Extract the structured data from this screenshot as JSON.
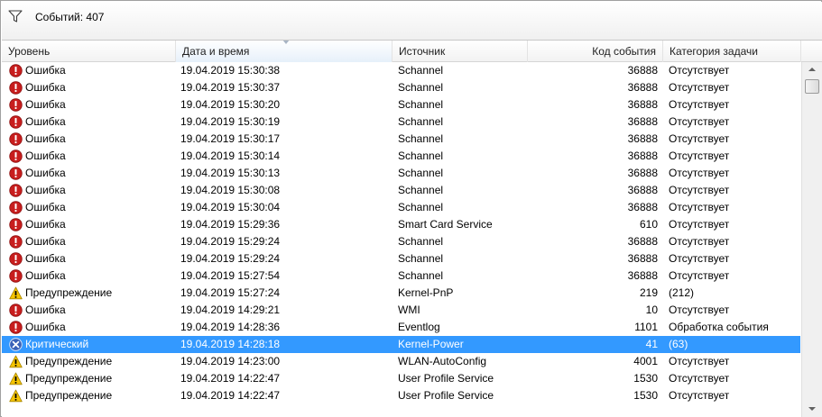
{
  "toolbar": {
    "filter_icon": "filter-icon",
    "events_count": "Событий: 407"
  },
  "columns": {
    "level": "Уровень",
    "datetime": "Дата и время",
    "source": "Источник",
    "event_code": "Код события",
    "task_category": "Категория задачи"
  },
  "icons": {
    "error": "error-icon",
    "warning": "warning-icon",
    "critical": "critical-icon"
  },
  "colors": {
    "selection": "#3399ff",
    "error_red": "#c81e1e",
    "warning_yellow": "#f5c400",
    "critical_blue": "#3a62b8"
  },
  "rows": [
    {
      "type": "error",
      "level": "Ошибка",
      "date": "19.04.2019 15:30:38",
      "source": "Schannel",
      "code": "36888",
      "category": "Отсутствует"
    },
    {
      "type": "error",
      "level": "Ошибка",
      "date": "19.04.2019 15:30:37",
      "source": "Schannel",
      "code": "36888",
      "category": "Отсутствует"
    },
    {
      "type": "error",
      "level": "Ошибка",
      "date": "19.04.2019 15:30:20",
      "source": "Schannel",
      "code": "36888",
      "category": "Отсутствует"
    },
    {
      "type": "error",
      "level": "Ошибка",
      "date": "19.04.2019 15:30:19",
      "source": "Schannel",
      "code": "36888",
      "category": "Отсутствует"
    },
    {
      "type": "error",
      "level": "Ошибка",
      "date": "19.04.2019 15:30:17",
      "source": "Schannel",
      "code": "36888",
      "category": "Отсутствует"
    },
    {
      "type": "error",
      "level": "Ошибка",
      "date": "19.04.2019 15:30:14",
      "source": "Schannel",
      "code": "36888",
      "category": "Отсутствует"
    },
    {
      "type": "error",
      "level": "Ошибка",
      "date": "19.04.2019 15:30:13",
      "source": "Schannel",
      "code": "36888",
      "category": "Отсутствует"
    },
    {
      "type": "error",
      "level": "Ошибка",
      "date": "19.04.2019 15:30:08",
      "source": "Schannel",
      "code": "36888",
      "category": "Отсутствует"
    },
    {
      "type": "error",
      "level": "Ошибка",
      "date": "19.04.2019 15:30:04",
      "source": "Schannel",
      "code": "36888",
      "category": "Отсутствует"
    },
    {
      "type": "error",
      "level": "Ошибка",
      "date": "19.04.2019 15:29:36",
      "source": "Smart Card Service",
      "code": "610",
      "category": "Отсутствует"
    },
    {
      "type": "error",
      "level": "Ошибка",
      "date": "19.04.2019 15:29:24",
      "source": "Schannel",
      "code": "36888",
      "category": "Отсутствует"
    },
    {
      "type": "error",
      "level": "Ошибка",
      "date": "19.04.2019 15:29:24",
      "source": "Schannel",
      "code": "36888",
      "category": "Отсутствует"
    },
    {
      "type": "error",
      "level": "Ошибка",
      "date": "19.04.2019 15:27:54",
      "source": "Schannel",
      "code": "36888",
      "category": "Отсутствует"
    },
    {
      "type": "warning",
      "level": "Предупреждение",
      "date": "19.04.2019 15:27:24",
      "source": "Kernel-PnP",
      "code": "219",
      "category": "(212)"
    },
    {
      "type": "error",
      "level": "Ошибка",
      "date": "19.04.2019 14:29:21",
      "source": "WMI",
      "code": "10",
      "category": "Отсутствует"
    },
    {
      "type": "error",
      "level": "Ошибка",
      "date": "19.04.2019 14:28:36",
      "source": "Eventlog",
      "code": "1101",
      "category": "Обработка события"
    },
    {
      "type": "critical",
      "level": "Критический",
      "date": "19.04.2019 14:28:18",
      "source": "Kernel-Power",
      "code": "41",
      "category": "(63)",
      "selected": true
    },
    {
      "type": "warning",
      "level": "Предупреждение",
      "date": "19.04.2019 14:23:00",
      "source": "WLAN-AutoConfig",
      "code": "4001",
      "category": "Отсутствует"
    },
    {
      "type": "warning",
      "level": "Предупреждение",
      "date": "19.04.2019 14:22:47",
      "source": "User Profile Service",
      "code": "1530",
      "category": "Отсутствует"
    },
    {
      "type": "warning",
      "level": "Предупреждение",
      "date": "19.04.2019 14:22:47",
      "source": "User Profile Service",
      "code": "1530",
      "category": "Отсутствует"
    }
  ]
}
